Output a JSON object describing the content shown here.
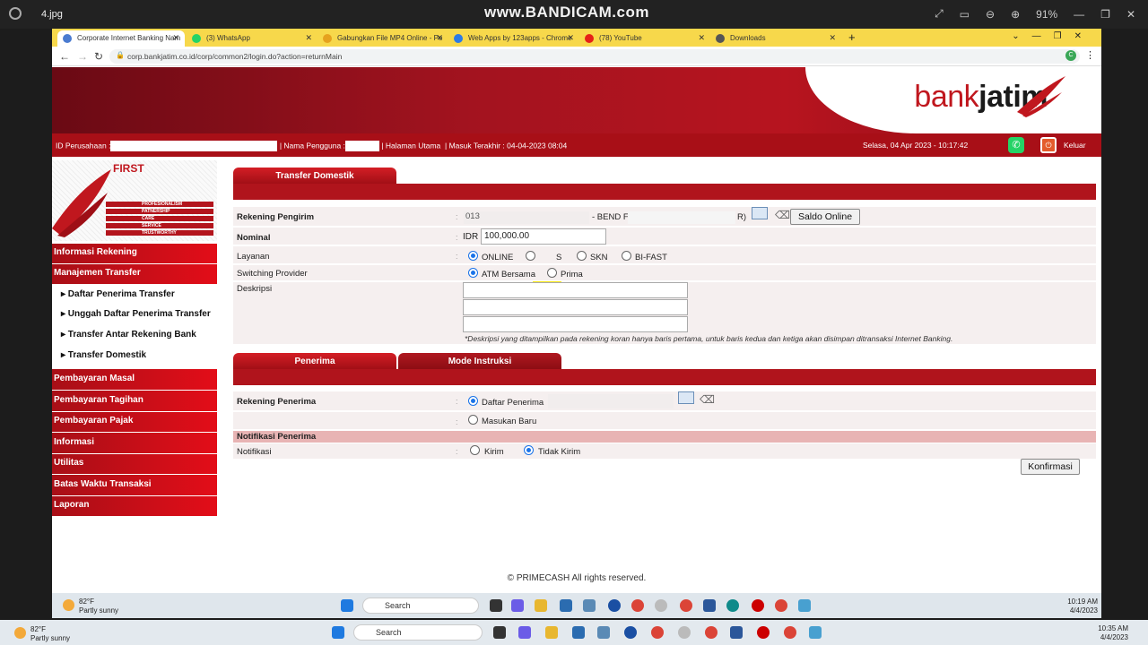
{
  "viewer": {
    "filename": "4.jpg",
    "watermark": "www.BANDICAM.com",
    "zoom": "91%"
  },
  "browser": {
    "tabs": [
      {
        "label": "Corporate Internet Banking Nam",
        "color": "#4a7bd0",
        "active": true
      },
      {
        "label": "(3) WhatsApp",
        "color": "#25d366"
      },
      {
        "label": "Gabungkan File MP4 Online - Pe",
        "color": "#e6a21e"
      },
      {
        "label": "Web Apps by 123apps - Chrome",
        "color": "#2d7be5"
      },
      {
        "label": "(78) YouTube",
        "color": "#e62117"
      },
      {
        "label": "Downloads",
        "color": "#555555"
      }
    ],
    "new_tab": "+",
    "url": "corp.bankjatim.co.id/corp/common2/login.do?action=returnMain",
    "profile_initial": "C"
  },
  "header": {
    "logo_bank": "bank",
    "logo_jatim": "jatim",
    "company_id_label": "ID Perusahaan :",
    "username_label": "| Nama Pengguna :",
    "home_label": "| Halaman Utama",
    "last_login_label": "| Masuk Terakhir : 04-04-2023 08:04",
    "datetime": "Selasa, 04 Apr 2023  - 10:17:42",
    "logout": "Keluar"
  },
  "sidebar": {
    "first_title": "FIRST",
    "first_values": [
      "PROFESIONALISM",
      "PATNERSHIP",
      "CARE",
      "SERVICE",
      "TRUSTWORTHY"
    ],
    "items": [
      {
        "label": "Informasi Rekening"
      },
      {
        "label": "Manajemen Transfer"
      },
      {
        "label": "Pembayaran Masal"
      },
      {
        "label": "Pembayaran Tagihan"
      },
      {
        "label": "Pembayaran Pajak"
      },
      {
        "label": "Informasi"
      },
      {
        "label": "Utilitas"
      },
      {
        "label": "Batas Waktu Transaksi"
      },
      {
        "label": "Laporan"
      }
    ],
    "subitems": [
      "▸ Daftar Penerima Transfer",
      "▸ Unggah Daftar Penerima Transfer",
      "▸ Transfer Antar Rekening Bank",
      "▸ Transfer Domestik"
    ]
  },
  "form": {
    "section_title": "Transfer Domestik",
    "sender_label": "Rekening Pengirim",
    "sender_account_prefix": "013",
    "sender_name_prefix": "- BEND F",
    "sender_name_suffix": "R)",
    "saldo_button": "Saldo Online",
    "amount_label": "Nominal",
    "currency": "IDR",
    "amount_value": "100,000.00",
    "service_label": "Layanan",
    "services": [
      "ONLINE",
      "S",
      "SKN",
      "BI-FAST"
    ],
    "switching_label": "Switching Provider",
    "switching": [
      "ATM Bersama",
      "Prima"
    ],
    "description_label": "Deskripsi",
    "description_note": "*Deskripsi yang ditampilkan pada rekening koran hanya baris pertama, untuk baris kedua dan ketiga akan disimpan ditransaksi Internet Banking.",
    "recipient_tab": "Penerima",
    "instruction_tab": "Mode Instruksi",
    "recipient_label": "Rekening Penerima",
    "recipient_options": [
      "Daftar Penerima",
      "Masukan Baru"
    ],
    "notification_section": "Notifikasi Penerima",
    "notification_label": "Notifikasi",
    "notification_options": [
      "Kirim",
      "Tidak Kirim"
    ],
    "confirm_button": "Konfirmasi",
    "colon": ":"
  },
  "footer": "© PRIMECASH All rights reserved.",
  "taskbar_inner": {
    "temp": "82°F",
    "weather": "Partly sunny",
    "search": "Search",
    "time": "10:19 AM",
    "date": "4/4/2023"
  },
  "taskbar_outer": {
    "temp": "82°F",
    "weather": "Partly sunny",
    "search": "Search",
    "time": "10:35 AM",
    "date": "4/4/2023"
  }
}
